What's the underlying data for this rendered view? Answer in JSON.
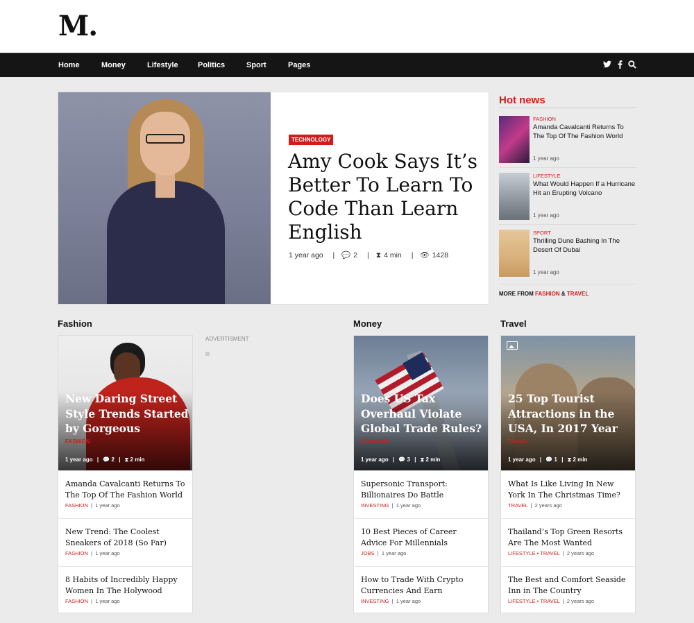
{
  "logo": "M.",
  "nav": {
    "items": [
      "Home",
      "Money",
      "Lifestyle",
      "Politics",
      "Sport",
      "Pages"
    ],
    "icons": [
      "twitter-icon",
      "facebook-icon",
      "search-icon"
    ]
  },
  "hero": {
    "badge": "TECHNOLOGY",
    "title": "Amy Cook Says It’s Better To Learn To Code Than Learn English",
    "time": "1 year ago",
    "comments": "2",
    "read": "4 min",
    "views": "1428"
  },
  "hot": {
    "title": "Hot news",
    "items": [
      {
        "cat": "FASHION",
        "title": "Amanda Cavalcanti Returns To The Top Of The Fashion World",
        "time": "1 year ago"
      },
      {
        "cat": "LIFESTYLE",
        "title": "What Would Happen If a Hurricane Hit an Erupting Volcano",
        "time": "1 year ago"
      },
      {
        "cat": "SPORT",
        "title": "Thrilling Dune Bashing In The Desert Of Dubai",
        "time": "1 year ago"
      }
    ],
    "more_prefix": "MORE FROM",
    "more_a": "FASHION",
    "more_amp": "&",
    "more_b": "TRAVEL"
  },
  "ad": {
    "label": "ADVERTISMENT"
  },
  "sections": [
    {
      "title": "Fashion",
      "feature": {
        "title": "New Daring Street Style Trends Started by Gorgeous",
        "cat": "FASHION",
        "time": "1 year ago",
        "comments": "2",
        "read": "2 min"
      },
      "list": [
        {
          "title": "Amanda Cavalcanti Returns To The Top Of The Fashion World",
          "cats": "FASHION",
          "time": "1 year ago"
        },
        {
          "title": "New Trend: The Coolest Sneakers of 2018 (So Far)",
          "cats": "FASHION",
          "time": "1 year ago"
        },
        {
          "title": "8 Habits of Incredibly Happy Women In The Holywood",
          "cats": "FASHION",
          "time": "1 year ago"
        }
      ]
    },
    {
      "title": "Money",
      "feature": {
        "title": "Does US Tax Overhaul Violate Global Trade Rules?",
        "cat": "ECONOMY",
        "time": "1 year ago",
        "comments": "3",
        "read": "2 min"
      },
      "list": [
        {
          "title": "Supersonic Transport: Billionaires Do Battle",
          "cats": "INVESTING",
          "time": "1 year ago"
        },
        {
          "title": "10 Best Pieces of Career Advice For Millennials",
          "cats": "JOBS",
          "time": "1 year ago"
        },
        {
          "title": "How to Trade With Crypto Currencies And Earn",
          "cats": "INVESTING",
          "time": "1 year ago"
        }
      ]
    },
    {
      "title": "Travel",
      "feature": {
        "title": "25 Top Tourist Attractions in the USA, In 2017 Year",
        "cat": "TRAVEL",
        "time": "1 year ago",
        "comments": "1",
        "read": "2 min"
      },
      "list": [
        {
          "title": "What Is Like Living In New York In The Christmas Time?",
          "cats": "TRAVEL",
          "time": "2 years ago"
        },
        {
          "title": "Thailand’s Top Green Resorts Are The Most Wanted",
          "cats": "LIFESTYLE • TRAVEL",
          "time": "2 years ago"
        },
        {
          "title": "The Best and Comfort Seaside Inn in The Country",
          "cats": "LIFESTYLE • TRAVEL",
          "time": "2 years ago"
        }
      ]
    }
  ],
  "colors": {
    "accent": "#d21b1b",
    "nav_bg": "#151515",
    "page_bg": "#ebebeb"
  }
}
